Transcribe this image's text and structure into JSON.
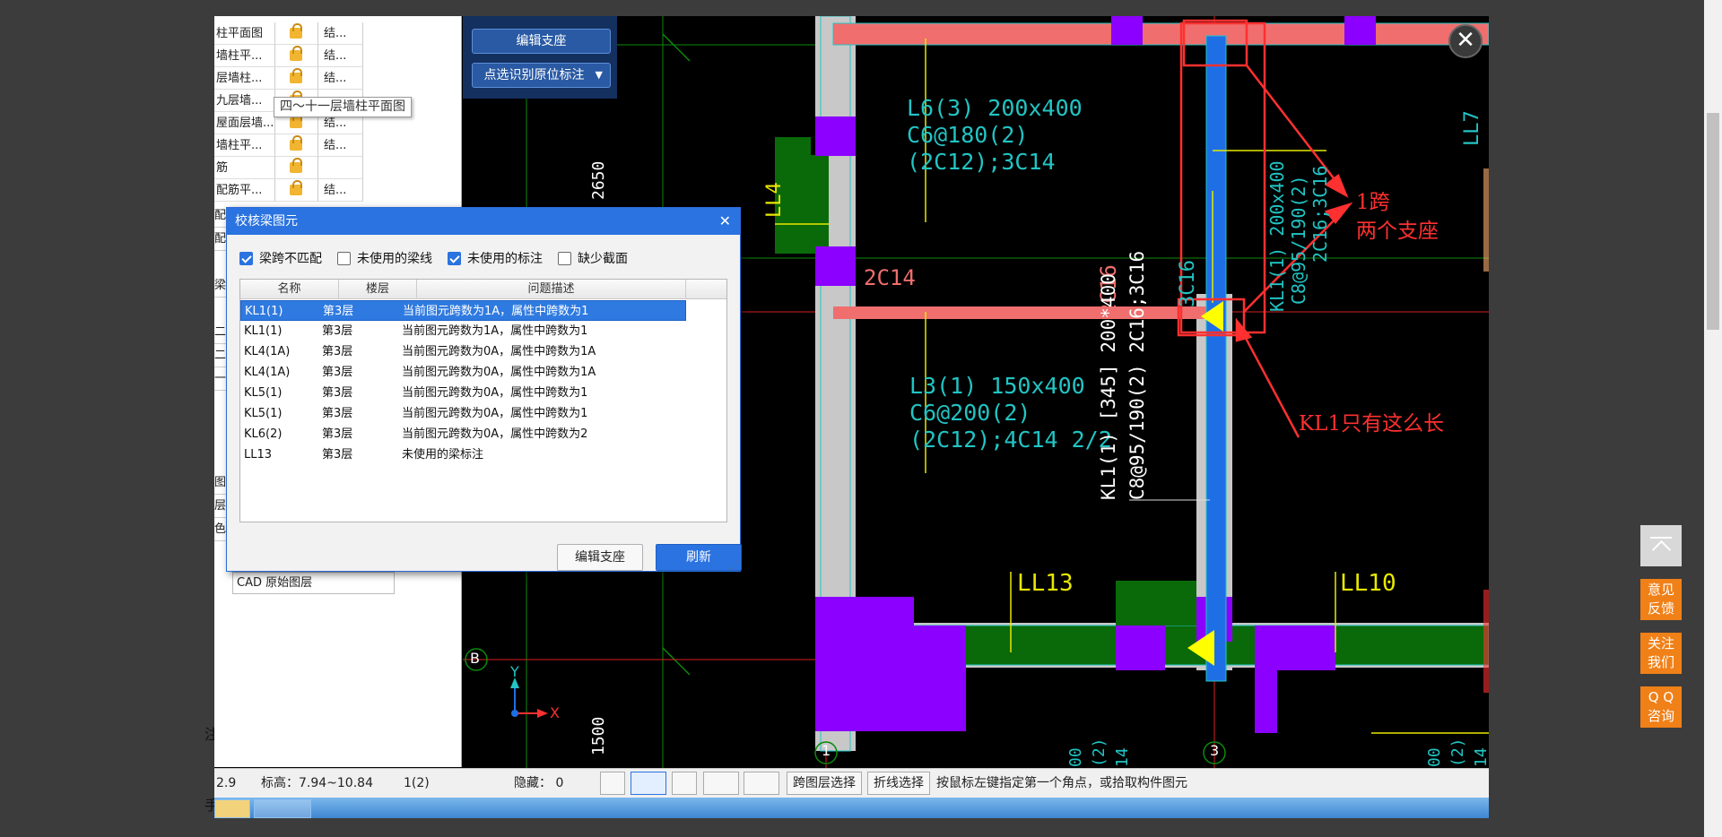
{
  "layer_table": {
    "rows": [
      {
        "name": "柱平面图",
        "type": "结..."
      },
      {
        "name": "墙柱平...",
        "type": "结..."
      },
      {
        "name": "层墙柱...",
        "type": "结..."
      },
      {
        "name": "九层墙...",
        "type": ""
      },
      {
        "name": "屋面层墙...",
        "type": "结..."
      },
      {
        "name": "墙柱平...",
        "type": "结..."
      },
      {
        "name": "筋",
        "type": ""
      },
      {
        "name": "配筋平...",
        "type": "结..."
      }
    ],
    "tooltip": "四～十一层墙柱平面图",
    "side_labels": [
      "配",
      "配",
      "梁",
      "二",
      "二",
      "一"
    ],
    "side_labels_lower": [
      "图",
      "层",
      "色"
    ],
    "cad_layer": "CAD 原始图层"
  },
  "cad_buttons": {
    "edit_support": "编辑支座",
    "pick_annotation": "点选识别原位标注"
  },
  "dialog": {
    "title": "校核梁图元",
    "filters": [
      {
        "label": "梁跨不匹配",
        "checked": true
      },
      {
        "label": "未使用的梁线",
        "checked": false
      },
      {
        "label": "未使用的标注",
        "checked": true
      },
      {
        "label": "缺少截面",
        "checked": false
      }
    ],
    "columns": [
      "名称",
      "楼层",
      "问题描述"
    ],
    "rows": [
      {
        "name": "KL1(1)",
        "floor": "第3层",
        "desc": "当前图元跨数为1A，属性中跨数为1",
        "selected": true
      },
      {
        "name": "KL1(1)",
        "floor": "第3层",
        "desc": "当前图元跨数为1A，属性中跨数为1",
        "selected": false
      },
      {
        "name": "KL4(1A)",
        "floor": "第3层",
        "desc": "当前图元跨数为0A，属性中跨数为1A",
        "selected": false
      },
      {
        "name": "KL4(1A)",
        "floor": "第3层",
        "desc": "当前图元跨数为0A，属性中跨数为1A",
        "selected": false
      },
      {
        "name": "KL5(1)",
        "floor": "第3层",
        "desc": "当前图元跨数为0A，属性中跨数为1",
        "selected": false
      },
      {
        "name": "KL5(1)",
        "floor": "第3层",
        "desc": "当前图元跨数为0A，属性中跨数为1",
        "selected": false
      },
      {
        "name": "KL6(2)",
        "floor": "第3层",
        "desc": "当前图元跨数为0A，属性中跨数为2",
        "selected": false
      },
      {
        "name": "LL13",
        "floor": "第3层",
        "desc": "未使用的梁标注",
        "selected": false
      }
    ],
    "btn_edit_support": "编辑支座",
    "btn_refresh": "刷新"
  },
  "drawing": {
    "dims": {
      "d2650": "2650",
      "d1500": "1500"
    },
    "axes": {
      "b": "B",
      "n1": "1",
      "n3": "3"
    },
    "labels": {
      "ll4": "LL4",
      "ll7": "LL7",
      "l6_1": "L6(3) 200x400",
      "l6_2": "C6@180(2)",
      "l6_3": "(2C12);3C14",
      "c2c14": "2C14",
      "c2c16": "2C16",
      "l3_1": "L3(1) 150x400",
      "l3_2": "C6@200(2)",
      "l3_3": "(2C12);4C14 2/2",
      "kl1_1": "KL1(1) [345] 200*400",
      "kl1_2": "C8@95/190(2) 2C16;3C16",
      "kl1r_1": "KL1(1) 200x400",
      "kl1r_2": "C8@95/190(2)",
      "kl1r_3": "2C16;3C16",
      "c3c16": "3C16",
      "ll13": "LL13",
      "ll10": "LL10",
      "axis_x": "X",
      "axis_y": "Y",
      "bottom_a": "00",
      "bottom_b": "(2)",
      "bottom_c": "14"
    },
    "annotations": {
      "span": "1跨",
      "supports": "两个支座",
      "length": "KL1只有这么长"
    },
    "colors": {
      "beam": "#f06e6e",
      "column": "#8b00ff",
      "wall": "#c8c8c8",
      "blue_beam": "#1e6fe6",
      "text_cyan": "#22c4c4",
      "red_box": "#ff3030"
    }
  },
  "status_bar": {
    "coord": "2.9",
    "elevation": "标高：7.94~10.84",
    "page": "1(2)",
    "hidden": "隐藏： 0",
    "cross_layer": "跨图层选择",
    "polyline": "折线选择",
    "hint": "按鼠标左键指定第一个角点，或拾取构件图元"
  },
  "side_tools": {
    "feedback": [
      "意见",
      "反馈"
    ],
    "follow": [
      "关注",
      "我们"
    ],
    "qq": [
      "Q Q",
      "咨询"
    ]
  },
  "page_edge": {
    "left1": "注",
    "left2": "手"
  }
}
